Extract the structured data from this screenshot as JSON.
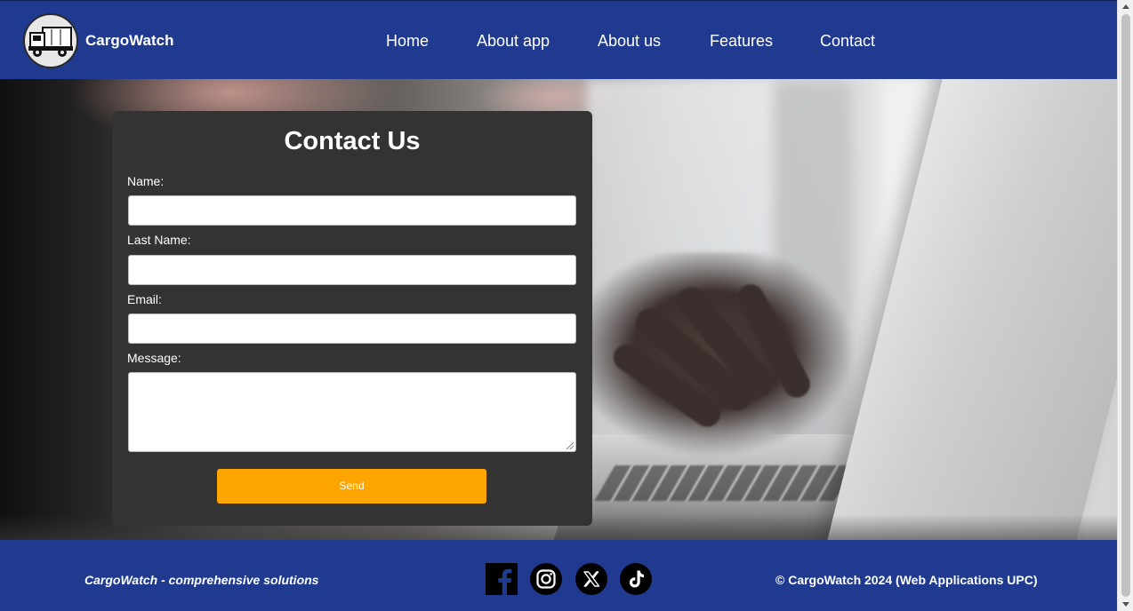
{
  "header": {
    "brand": "CargoWatch",
    "logo_icon": "truck-icon",
    "nav": [
      {
        "label": "Home"
      },
      {
        "label": "About app"
      },
      {
        "label": "About us"
      },
      {
        "label": "Features"
      },
      {
        "label": "Contact"
      }
    ]
  },
  "form": {
    "title": "Contact Us",
    "fields": [
      {
        "label": "Name:",
        "value": ""
      },
      {
        "label": "Last Name:",
        "value": ""
      },
      {
        "label": "Email:",
        "value": ""
      },
      {
        "label": "Message:",
        "value": ""
      }
    ],
    "submit_label": "Send"
  },
  "footer": {
    "tagline": "CargoWatch - comprehensive solutions",
    "copyright": "© CargoWatch 2024 (Web Applications UPC)",
    "social": [
      "facebook-icon",
      "instagram-icon",
      "x-icon",
      "tiktok-icon"
    ]
  },
  "colors": {
    "header_bg": "#1f3a8f",
    "card_bg": "#333333",
    "button": "#ffa500"
  }
}
